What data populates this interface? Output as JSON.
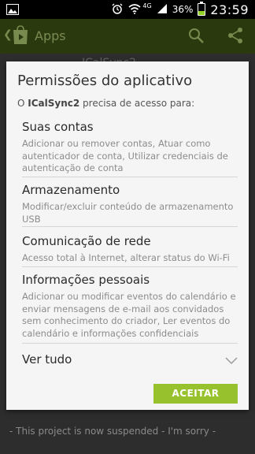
{
  "status_bar": {
    "time": "23:59",
    "battery_percent": "36%",
    "battery_level": 0.36,
    "network": "4G",
    "icons": [
      "gallery-notification-icon",
      "alarm-icon",
      "wifi-icon",
      "signal-icon",
      "battery-icon"
    ]
  },
  "app_bar": {
    "title": "Apps",
    "icons": [
      "back-icon",
      "play-store-icon",
      "search-icon",
      "share-icon"
    ]
  },
  "background": {
    "app_name_partial": "ICalSync2",
    "footer": "- This project is now suspended - I'm sorry -"
  },
  "dialog": {
    "title": "Permissões do aplicativo",
    "subtitle_prefix": "O ",
    "app_name": "ICalSync2",
    "subtitle_suffix": " precisa de acesso para:",
    "permissions": [
      {
        "title": "Suas contas",
        "description": "Adicionar ou remover contas, Atuar como autenticador de conta, Utilizar credenciais de autenticação de conta"
      },
      {
        "title": "Armazenamento",
        "description": "Modificar/excluir conteúdo de armazenamento USB"
      },
      {
        "title": "Comunicação de rede",
        "description": "Acesso total à Internet, alterar status do Wi-Fi"
      },
      {
        "title": "Informações pessoais",
        "description": "Adicionar ou modificar eventos do calendário e enviar mensagens de e-mail aos convidados sem conhecimento do criador, Ler eventos do calendário e informações confidenciais"
      }
    ],
    "see_all": "Ver tudo",
    "accept_button": "ACEITAR"
  },
  "colors": {
    "accent_green": "#98c12e",
    "appbar_bg": "#2b3a0e",
    "battery_green": "#8fd126"
  }
}
